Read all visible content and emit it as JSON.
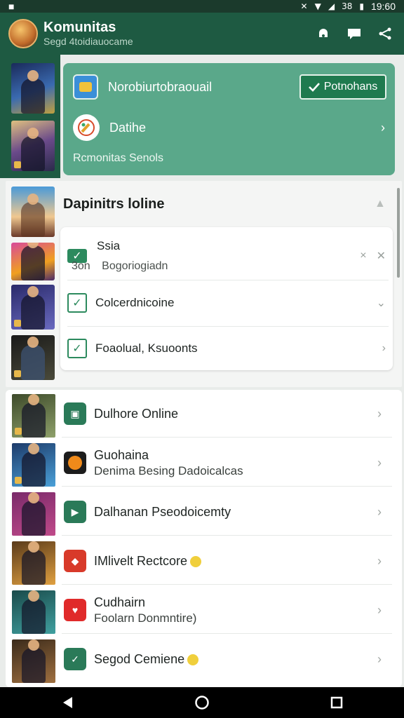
{
  "status_bar": {
    "time": "19:60",
    "signal_text": "38"
  },
  "app_bar": {
    "title": "Komunitas",
    "subtitle": "Segd 4toidiauocame",
    "actions": [
      "notification-icon",
      "chat-icon",
      "share-icon"
    ]
  },
  "hero": {
    "app_label": "Norobiurtobraouail",
    "cta_label": "Potnohans",
    "row2_label": "Datihe",
    "footer": "Rcmonitas Senols"
  },
  "section1": {
    "title": "Dapinitrs loline",
    "items": [
      {
        "label": "Ssia",
        "sub_prefix": "3on",
        "sub_text": "Bogoriogiadn"
      },
      {
        "label": "Colcerdnicoine"
      },
      {
        "label": "Foaolual, Ksuoonts"
      }
    ]
  },
  "list": {
    "items": [
      {
        "title": "Dulhore Online",
        "subtitle": "",
        "icon_color": "#2a7a58",
        "thumb": [
          "#3d4a2a",
          "#8ea06a"
        ]
      },
      {
        "title": "Guohaina",
        "subtitle": "Denima Besing Dadoicalcas",
        "icon_color": "#1c1c1c",
        "thumb": [
          "#1d3b6a",
          "#4aa0d8"
        ]
      },
      {
        "title": "Dalhanan Pseodoicemty",
        "subtitle": "",
        "icon_color": "#2a7a58",
        "thumb": [
          "#7a2a6a",
          "#c04a8a"
        ]
      },
      {
        "title": "IMlivelt Rectcore",
        "subtitle": "",
        "icon_color": "#d83a2a",
        "thumb": [
          "#5a3a1a",
          "#e0a040"
        ]
      },
      {
        "title": "Cudhairn",
        "subtitle": "Foolarn Donmntire)",
        "icon_color": "#e02a2a",
        "thumb": [
          "#1a4a4a",
          "#40a0a0"
        ]
      },
      {
        "title": "Segod Cemiene",
        "subtitle": "",
        "icon_color": "#2a7a58",
        "thumb": [
          "#3a2a1a",
          "#a07040"
        ]
      }
    ]
  },
  "colors": {
    "primary": "#1e5a42",
    "hero": "#5aa88a",
    "accent": "#2c8a5e"
  }
}
